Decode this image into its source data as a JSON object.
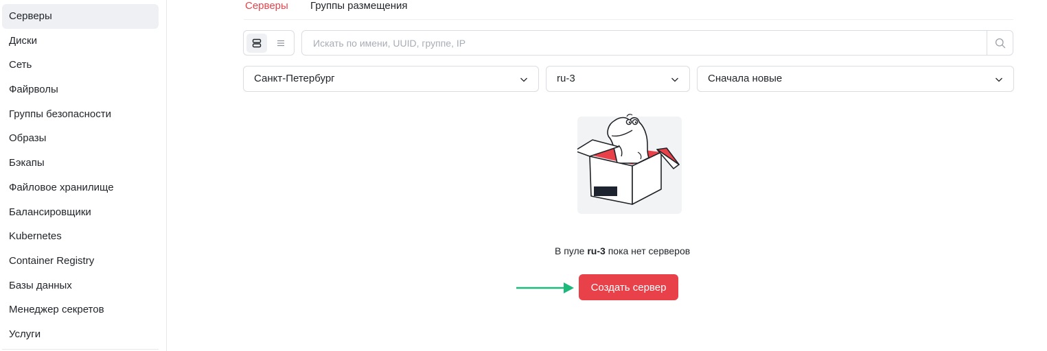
{
  "sidebar": {
    "items": [
      {
        "label": "Серверы",
        "active": true
      },
      {
        "label": "Диски"
      },
      {
        "label": "Сеть"
      },
      {
        "label": "Файрволы"
      },
      {
        "label": "Группы безопасности"
      },
      {
        "label": "Образы"
      },
      {
        "label": "Бэкапы"
      },
      {
        "label": "Файловое хранилище"
      },
      {
        "label": "Балансировщики"
      },
      {
        "label": "Kubernetes"
      },
      {
        "label": "Container Registry"
      },
      {
        "label": "Базы данных"
      },
      {
        "label": "Менеджер секретов"
      },
      {
        "label": "Услуги"
      }
    ]
  },
  "tabs": [
    {
      "label": "Серверы",
      "active": true
    },
    {
      "label": "Группы размещения"
    }
  ],
  "toolbar": {
    "view_modes": [
      "cards-view-icon",
      "list-view-icon"
    ],
    "search_placeholder": "Искать по имени, UUID, группе, IP",
    "search_value": ""
  },
  "filters": {
    "region": "Санкт-Петербург",
    "pool": "ru-3",
    "sort": "Сначала новые"
  },
  "empty_state": {
    "text_before": "В пуле ",
    "pool_name": "ru-3",
    "text_after": " пока нет серверов",
    "button_label": "Создать сервер"
  },
  "colors": {
    "accent": "#e8414a",
    "arrow": "#1cb97a",
    "active_bg": "#eef0f3"
  }
}
